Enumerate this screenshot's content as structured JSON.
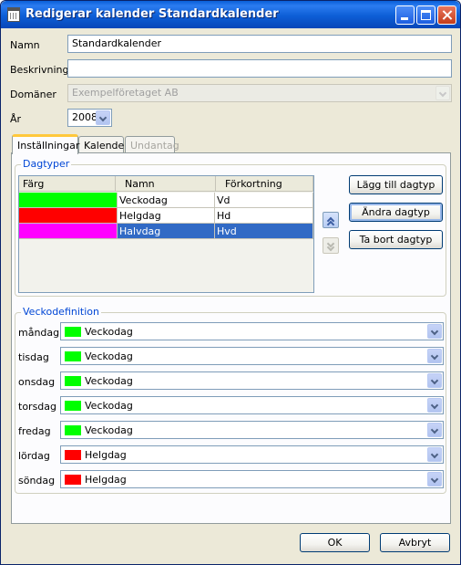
{
  "window": {
    "title": "Redigerar kalender Standardkalender"
  },
  "form": {
    "name_label": "Namn",
    "name_value": "Standardkalender",
    "description_label": "Beskrivning",
    "description_value": "",
    "domains_label": "Domäner",
    "domains_value": "Exempelföretaget AB",
    "year_label": "År",
    "year_value": "2008"
  },
  "tabs": [
    {
      "label": "Inställningar",
      "state": "active"
    },
    {
      "label": "Kalender",
      "state": "normal"
    },
    {
      "label": "Undantag",
      "state": "disabled"
    }
  ],
  "daytypes": {
    "group_title": "Dagtyper",
    "columns": [
      "Färg",
      "Namn",
      "Förkortning"
    ],
    "rows": [
      {
        "color": "#00ff00",
        "name": "Veckodag",
        "abbr": "Vd",
        "selected": false
      },
      {
        "color": "#ff0000",
        "name": "Helgdag",
        "abbr": "Hd",
        "selected": false
      },
      {
        "color": "#ff00ff",
        "name": "Halvdag",
        "abbr": "Hvd",
        "selected": true
      }
    ],
    "add_label": "Lägg till dagtyp",
    "edit_label": "Ändra dagtyp",
    "remove_label": "Ta bort dagtyp"
  },
  "week": {
    "group_title": "Veckodefinition",
    "days": [
      {
        "label": "måndag",
        "value": "Veckodag",
        "color": "#00ff00"
      },
      {
        "label": "tisdag",
        "value": "Veckodag",
        "color": "#00ff00"
      },
      {
        "label": "onsdag",
        "value": "Veckodag",
        "color": "#00ff00"
      },
      {
        "label": "torsdag",
        "value": "Veckodag",
        "color": "#00ff00"
      },
      {
        "label": "fredag",
        "value": "Veckodag",
        "color": "#00ff00"
      },
      {
        "label": "lördag",
        "value": "Helgdag",
        "color": "#ff0000"
      },
      {
        "label": "söndag",
        "value": "Helgdag",
        "color": "#ff0000"
      }
    ]
  },
  "footer": {
    "ok_label": "OK",
    "cancel_label": "Avbryt"
  }
}
